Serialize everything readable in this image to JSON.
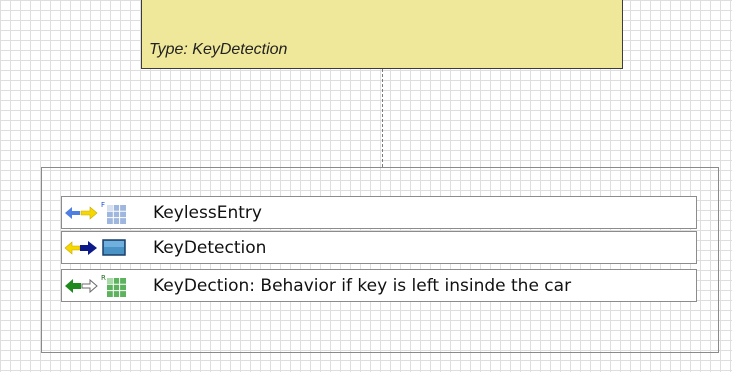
{
  "type_block": {
    "label": "Type: KeyDetection"
  },
  "elements": [
    {
      "name": "KeylessEntry",
      "direction": "bidirectional",
      "arrow_colors": [
        "#4f7fe0",
        "#f5d800"
      ],
      "icon": "feature-grid-icon",
      "badge": "F",
      "icon_color": "#7f9fd0"
    },
    {
      "name": "KeyDetection",
      "direction": "provided",
      "arrow_colors": [
        "#f5d800",
        "#0d1a8a"
      ],
      "icon": "block-icon",
      "icon_color": "#3f86b8"
    },
    {
      "name": "KeyDection: Behavior if key is left insinde the car",
      "direction": "required",
      "arrow_colors": [
        "#1e8a1e",
        "#ffffff"
      ],
      "icon": "requirement-grid-icon",
      "badge": "R",
      "icon_color": "#4aa84a"
    }
  ]
}
